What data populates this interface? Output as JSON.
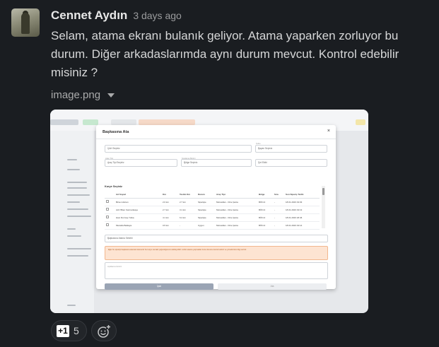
{
  "message": {
    "author": "Cennet Aydın",
    "timestamp": "3 days ago",
    "text": "Selam, atama ekranı bulanık geliyor. Atama yaparken zorluyor bu durum. Diğer arkadaslarımda aynı durum mevcut. Kontrol edebilir misiniz ?"
  },
  "attachment": {
    "file_name": "image.png",
    "screenshot": {
      "modal_title": "Başkasına Ata",
      "fields": {
        "f1": "İl Art Seçiniz",
        "f2_label": "Şube",
        "f2": "Bayan Seçiniz",
        "f3_label": "Araç Tipi",
        "f3": "Araç Tipi Seçiniz",
        "f4_label": "Sıralama Biçimi",
        "f4": "Bölge Seçiniz",
        "f5": "Sırt Ekibi"
      },
      "section_title": "Kurye Seçiniz",
      "columns": [
        "",
        "Ad Soyad",
        "Km",
        "Teslim Km",
        "Durum",
        "Araç Tipi",
        "Bölge",
        "Sıra",
        "Son Sipariş Tarihi"
      ],
      "rows": [
        [
          "",
          "Birsen Akcan",
          "2.0 km",
          "2.7 km",
          "Siparişte",
          "Motosiklet - Orta Çanta",
          "BÖN-3",
          "-",
          "18.01.2023 19:03"
        ],
        [
          "",
          "Aziz Bilen Karmankaya",
          "2.7 km",
          "3.1 km",
          "Siparişte",
          "Motosiklet - Orta Çanta",
          "BÖN-3",
          "-",
          "18.01.2023 19:13"
        ],
        [
          "",
          "Hacı Durmuş Yolka",
          "4.1 km",
          "6.4 km",
          "Siparişte",
          "Motosiklet - Orta Çanta",
          "BÖN-3",
          "-",
          "18.01.2023 18:46"
        ],
        [
          "",
          "Mustafa Balkaya",
          "0.5 km",
          "-",
          "Uygun",
          "Motosiklet - Orta Çanta",
          "BÖN-3",
          "-",
          "18.01.2023 19:14"
        ]
      ],
      "reason_placeholder": "Başkasına Atama Sebebi",
      "warning": "Eğer bu siparişi başkasına atamak isterseniz bu kurye sonraki yoğunluğunuzu etkileyebilir. Lütfen atama yapmadan önce durumu kontrol ediniz ve yöneticinize bilgi veriniz.",
      "note_placeholder": "Açıklama Giriniz",
      "primary_button": "İptal",
      "secondary_button": "Ata"
    }
  },
  "reactions": {
    "plus_one_label": "+1",
    "plus_one_count": "5"
  }
}
